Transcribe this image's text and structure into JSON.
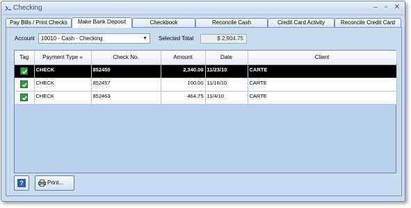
{
  "window": {
    "title": "Checking"
  },
  "tabs": [
    {
      "label": "Pay Bills / Print Checks",
      "active": false
    },
    {
      "label": "Make Bank Deposit",
      "active": true
    },
    {
      "label": "Checkbook",
      "active": false
    },
    {
      "label": "Reconcile Cash",
      "active": false
    },
    {
      "label": "Credit Card Activity",
      "active": false
    },
    {
      "label": "Reconcile Credit Card",
      "active": false
    }
  ],
  "account": {
    "label": "Account",
    "value": "10010 - Cash - Checking"
  },
  "selected_total": {
    "label": "Selected Total",
    "value": "$ 2,904.75"
  },
  "grid": {
    "columns": [
      "Tag",
      "Payment Type »",
      "Check No.",
      "Amount",
      "Date",
      "Client"
    ],
    "rows": [
      {
        "tagged": true,
        "payment_type": "CHECK",
        "check_no": "852450",
        "amount": "2,340.00",
        "date": "11/23/10",
        "client": "CARTE",
        "selected": true
      },
      {
        "tagged": true,
        "payment_type": "CHECK",
        "check_no": "852457",
        "amount": "100.00",
        "date": "11/16/10",
        "client": "CARTE",
        "selected": false
      },
      {
        "tagged": true,
        "payment_type": "CHECK",
        "check_no": "852463",
        "amount": "464.75",
        "date": "11/4/10",
        "client": "CARTE",
        "selected": false
      }
    ]
  },
  "buttons": {
    "help_label": "?",
    "print_label": "Print..."
  },
  "colors": {
    "window_bg": "#c9dcf0",
    "selected_row": "#000000",
    "checkbox": "#2f9e3d"
  }
}
